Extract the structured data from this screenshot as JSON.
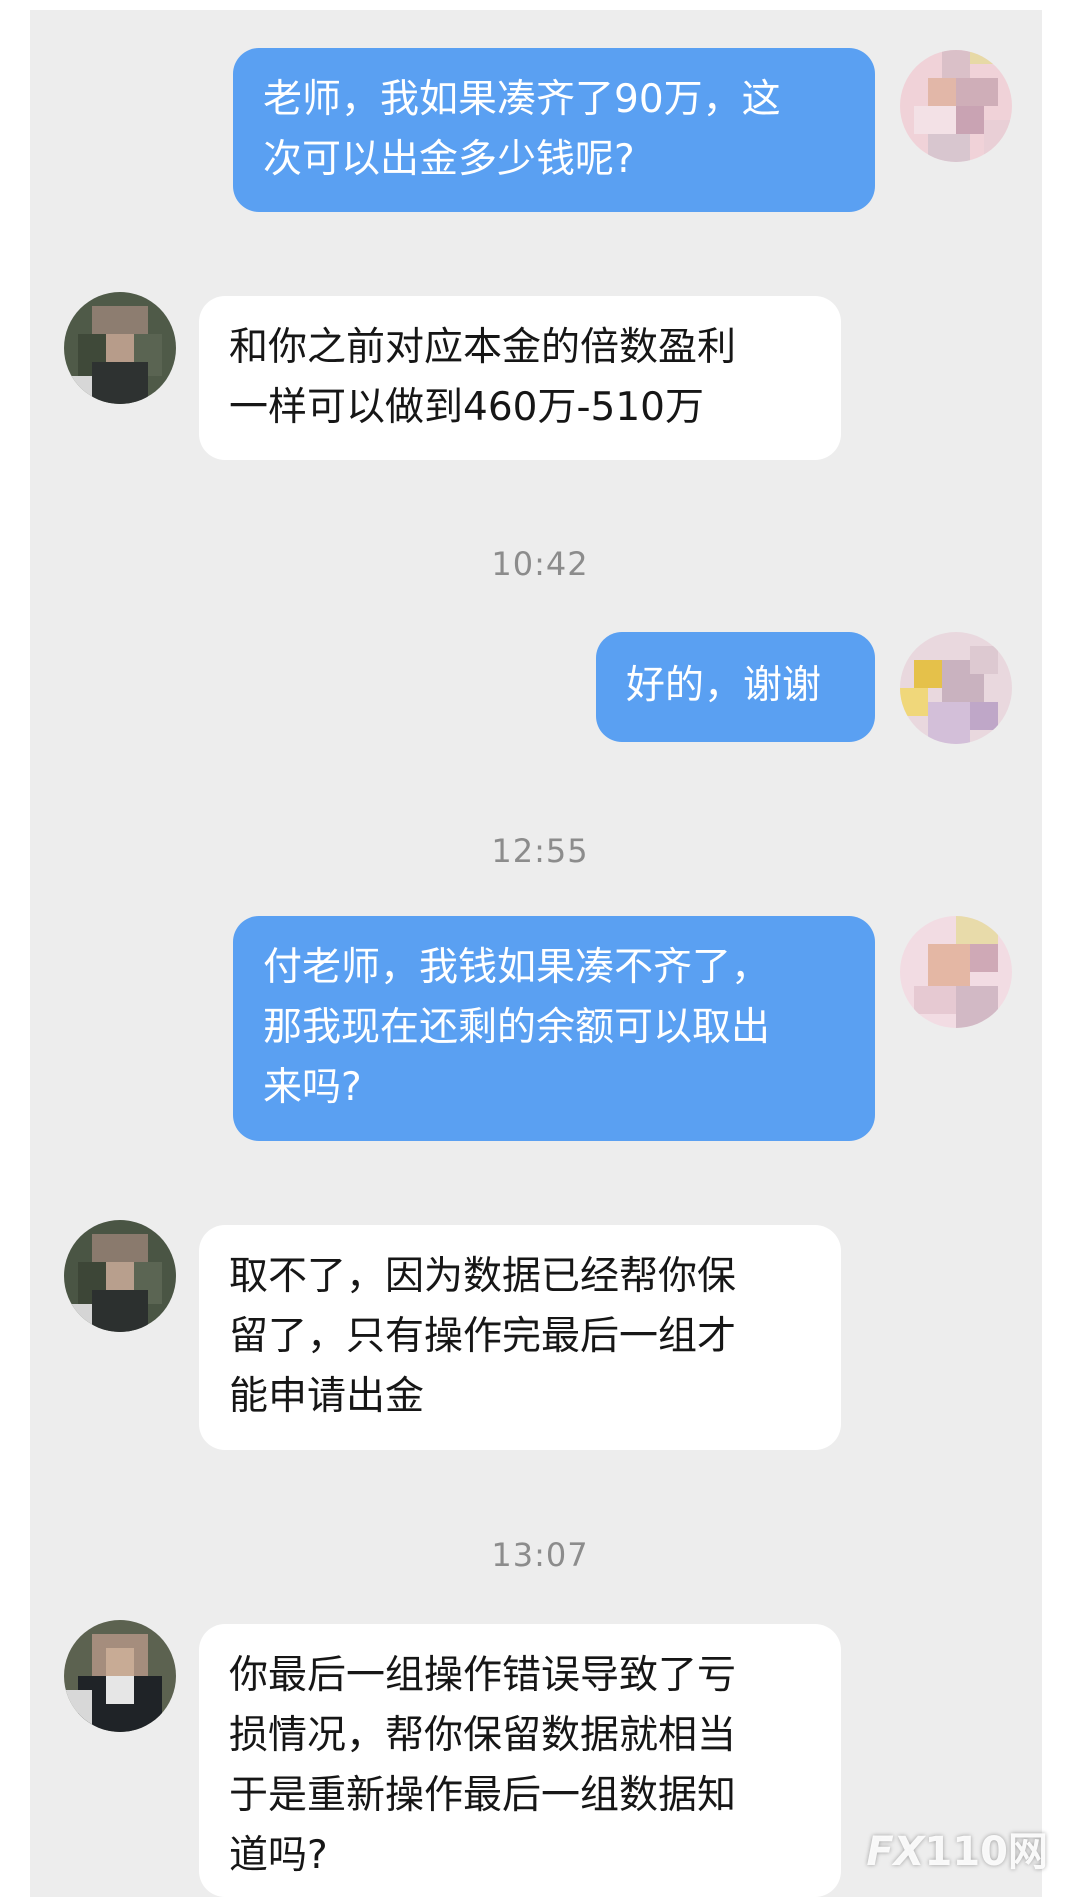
{
  "messages": [
    {
      "side": "out",
      "text": "老师，我如果凑齐了90万，这\n次可以出金多少钱呢?"
    },
    {
      "side": "in",
      "text": "和你之前对应本金的倍数盈利\n一样可以做到460万-510万"
    },
    {
      "type": "time",
      "text": "10:42"
    },
    {
      "side": "out",
      "text": "好的，谢谢"
    },
    {
      "type": "time",
      "text": "12:55"
    },
    {
      "side": "out",
      "text": "付老师，我钱如果凑不齐了，\n那我现在还剩的余额可以取出\n来吗?"
    },
    {
      "side": "in",
      "text": "取不了，因为数据已经帮你保\n留了，只有操作完最后一组才\n能申请出金"
    },
    {
      "type": "time",
      "text": "13:07"
    },
    {
      "side": "in",
      "text": "你最后一组操作错误导致了亏\n损情况，帮你保留数据就相当\n于是重新操作最后一组数据知\n道吗?"
    }
  ],
  "watermark": {
    "fx": "FX",
    "rest": "110网"
  },
  "colors": {
    "outgoing_bubble": "#5aa0f2",
    "incoming_bubble": "#ffffff",
    "background": "#ededed",
    "timestamp": "#8c8c8c"
  },
  "icons": {
    "my_avatar": "pixelated-avatar-icon",
    "contact_avatar": "pixelated-avatar-icon"
  }
}
